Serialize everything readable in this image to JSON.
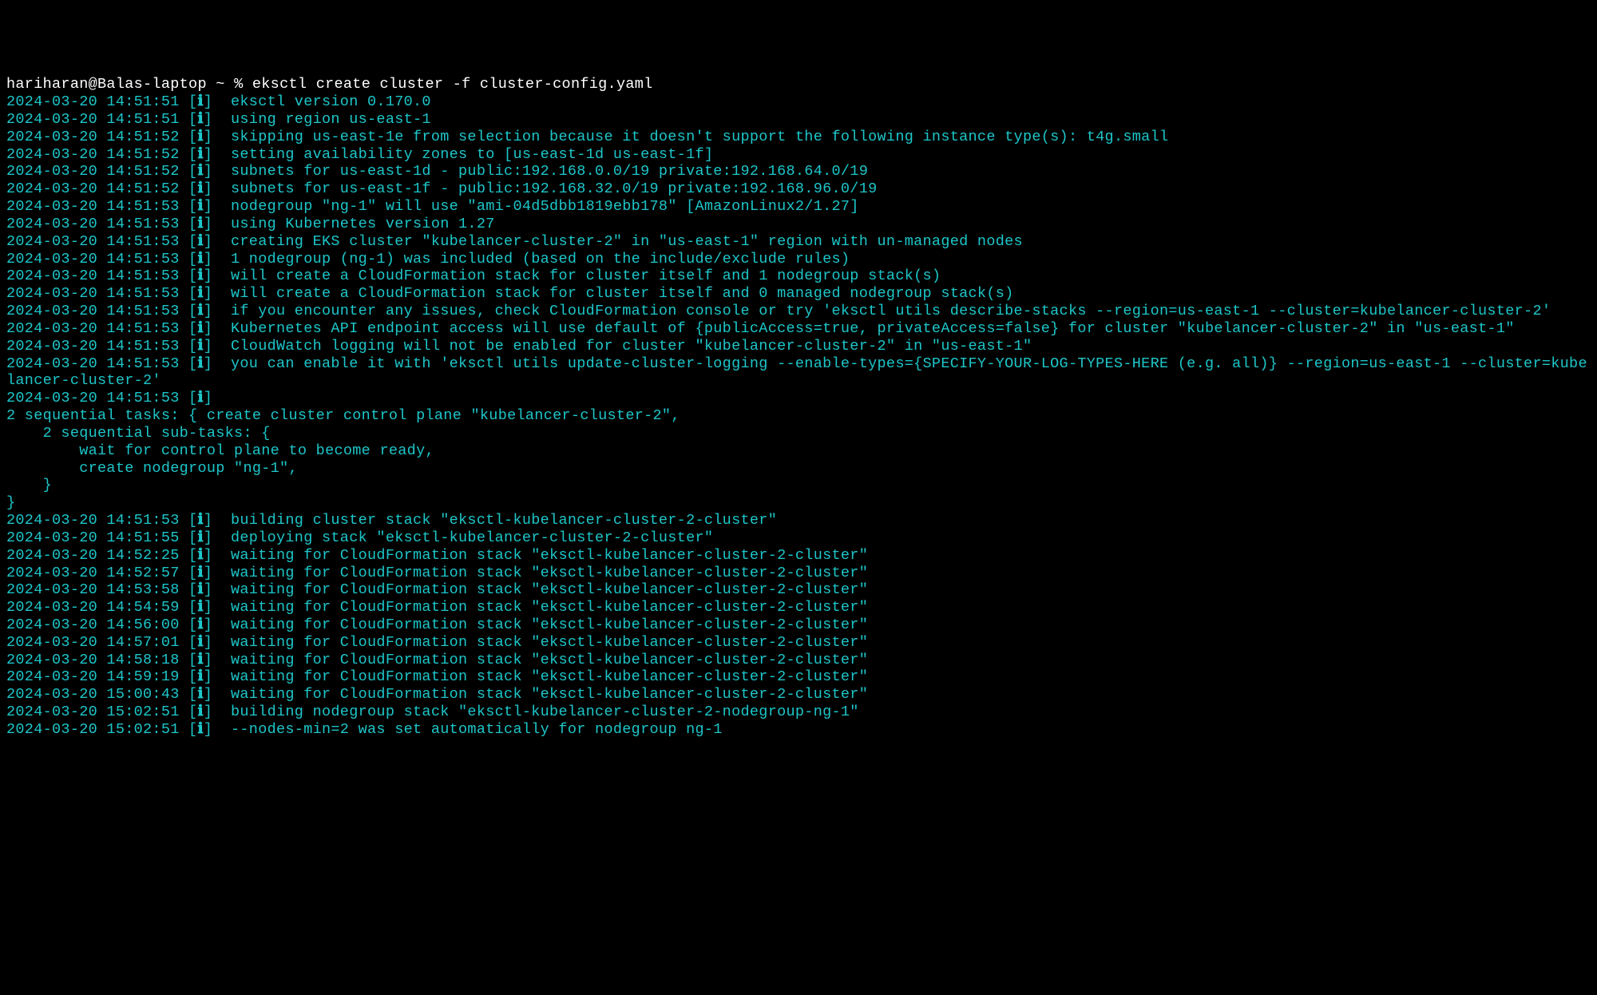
{
  "prompt": {
    "user_host": "hariharan@Balas-laptop",
    "path": "~",
    "symbol": "%",
    "command": "eksctl create cluster -f cluster-config.yaml"
  },
  "log_lines": [
    {
      "ts": "2024-03-20 14:51:51",
      "lvl": "ℹ",
      "msg": "eksctl version 0.170.0"
    },
    {
      "ts": "2024-03-20 14:51:51",
      "lvl": "ℹ",
      "msg": "using region us-east-1"
    },
    {
      "ts": "2024-03-20 14:51:52",
      "lvl": "ℹ",
      "msg": "skipping us-east-1e from selection because it doesn't support the following instance type(s): t4g.small"
    },
    {
      "ts": "2024-03-20 14:51:52",
      "lvl": "ℹ",
      "msg": "setting availability zones to [us-east-1d us-east-1f]"
    },
    {
      "ts": "2024-03-20 14:51:52",
      "lvl": "ℹ",
      "msg": "subnets for us-east-1d - public:192.168.0.0/19 private:192.168.64.0/19"
    },
    {
      "ts": "2024-03-20 14:51:52",
      "lvl": "ℹ",
      "msg": "subnets for us-east-1f - public:192.168.32.0/19 private:192.168.96.0/19"
    },
    {
      "ts": "2024-03-20 14:51:53",
      "lvl": "ℹ",
      "msg": "nodegroup \"ng-1\" will use \"ami-04d5dbb1819ebb178\" [AmazonLinux2/1.27]"
    },
    {
      "ts": "2024-03-20 14:51:53",
      "lvl": "ℹ",
      "msg": "using Kubernetes version 1.27"
    },
    {
      "ts": "2024-03-20 14:51:53",
      "lvl": "ℹ",
      "msg": "creating EKS cluster \"kubelancer-cluster-2\" in \"us-east-1\" region with un-managed nodes"
    },
    {
      "ts": "2024-03-20 14:51:53",
      "lvl": "ℹ",
      "msg": "1 nodegroup (ng-1) was included (based on the include/exclude rules)"
    },
    {
      "ts": "2024-03-20 14:51:53",
      "lvl": "ℹ",
      "msg": "will create a CloudFormation stack for cluster itself and 1 nodegroup stack(s)"
    },
    {
      "ts": "2024-03-20 14:51:53",
      "lvl": "ℹ",
      "msg": "will create a CloudFormation stack for cluster itself and 0 managed nodegroup stack(s)"
    },
    {
      "ts": "2024-03-20 14:51:53",
      "lvl": "ℹ",
      "msg": "if you encounter any issues, check CloudFormation console or try 'eksctl utils describe-stacks --region=us-east-1 --cluster=kubelancer-cluster-2'"
    },
    {
      "ts": "2024-03-20 14:51:53",
      "lvl": "ℹ",
      "msg": "Kubernetes API endpoint access will use default of {publicAccess=true, privateAccess=false} for cluster \"kubelancer-cluster-2\" in \"us-east-1\""
    },
    {
      "ts": "2024-03-20 14:51:53",
      "lvl": "ℹ",
      "msg": "CloudWatch logging will not be enabled for cluster \"kubelancer-cluster-2\" in \"us-east-1\""
    },
    {
      "ts": "2024-03-20 14:51:53",
      "lvl": "ℹ",
      "msg": "you can enable it with 'eksctl utils update-cluster-logging --enable-types={SPECIFY-YOUR-LOG-TYPES-HERE (e.g. all)} --region=us-east-1 --cluster=kubelancer-cluster-2'"
    },
    {
      "ts": "2024-03-20 14:51:53",
      "lvl": "ℹ",
      "msg": ""
    },
    {
      "ts": "",
      "lvl": "",
      "msg": "2 sequential tasks: { create cluster control plane \"kubelancer-cluster-2\",",
      "raw": true
    },
    {
      "ts": "",
      "lvl": "",
      "msg": "    2 sequential sub-tasks: {",
      "raw": true
    },
    {
      "ts": "",
      "lvl": "",
      "msg": "        wait for control plane to become ready,",
      "raw": true
    },
    {
      "ts": "",
      "lvl": "",
      "msg": "        create nodegroup \"ng-1\",",
      "raw": true
    },
    {
      "ts": "",
      "lvl": "",
      "msg": "    }",
      "raw": true
    },
    {
      "ts": "",
      "lvl": "",
      "msg": "}",
      "raw": true
    },
    {
      "ts": "2024-03-20 14:51:53",
      "lvl": "ℹ",
      "msg": "building cluster stack \"eksctl-kubelancer-cluster-2-cluster\""
    },
    {
      "ts": "2024-03-20 14:51:55",
      "lvl": "ℹ",
      "msg": "deploying stack \"eksctl-kubelancer-cluster-2-cluster\""
    },
    {
      "ts": "2024-03-20 14:52:25",
      "lvl": "ℹ",
      "msg": "waiting for CloudFormation stack \"eksctl-kubelancer-cluster-2-cluster\""
    },
    {
      "ts": "2024-03-20 14:52:57",
      "lvl": "ℹ",
      "msg": "waiting for CloudFormation stack \"eksctl-kubelancer-cluster-2-cluster\""
    },
    {
      "ts": "2024-03-20 14:53:58",
      "lvl": "ℹ",
      "msg": "waiting for CloudFormation stack \"eksctl-kubelancer-cluster-2-cluster\""
    },
    {
      "ts": "2024-03-20 14:54:59",
      "lvl": "ℹ",
      "msg": "waiting for CloudFormation stack \"eksctl-kubelancer-cluster-2-cluster\""
    },
    {
      "ts": "2024-03-20 14:56:00",
      "lvl": "ℹ",
      "msg": "waiting for CloudFormation stack \"eksctl-kubelancer-cluster-2-cluster\""
    },
    {
      "ts": "2024-03-20 14:57:01",
      "lvl": "ℹ",
      "msg": "waiting for CloudFormation stack \"eksctl-kubelancer-cluster-2-cluster\""
    },
    {
      "ts": "2024-03-20 14:58:18",
      "lvl": "ℹ",
      "msg": "waiting for CloudFormation stack \"eksctl-kubelancer-cluster-2-cluster\""
    },
    {
      "ts": "2024-03-20 14:59:19",
      "lvl": "ℹ",
      "msg": "waiting for CloudFormation stack \"eksctl-kubelancer-cluster-2-cluster\""
    },
    {
      "ts": "2024-03-20 15:00:43",
      "lvl": "ℹ",
      "msg": "waiting for CloudFormation stack \"eksctl-kubelancer-cluster-2-cluster\""
    },
    {
      "ts": "2024-03-20 15:02:51",
      "lvl": "ℹ",
      "msg": "building nodegroup stack \"eksctl-kubelancer-cluster-2-nodegroup-ng-1\""
    },
    {
      "ts": "2024-03-20 15:02:51",
      "lvl": "ℹ",
      "msg": "--nodes-min=2 was set automatically for nodegroup ng-1"
    }
  ]
}
